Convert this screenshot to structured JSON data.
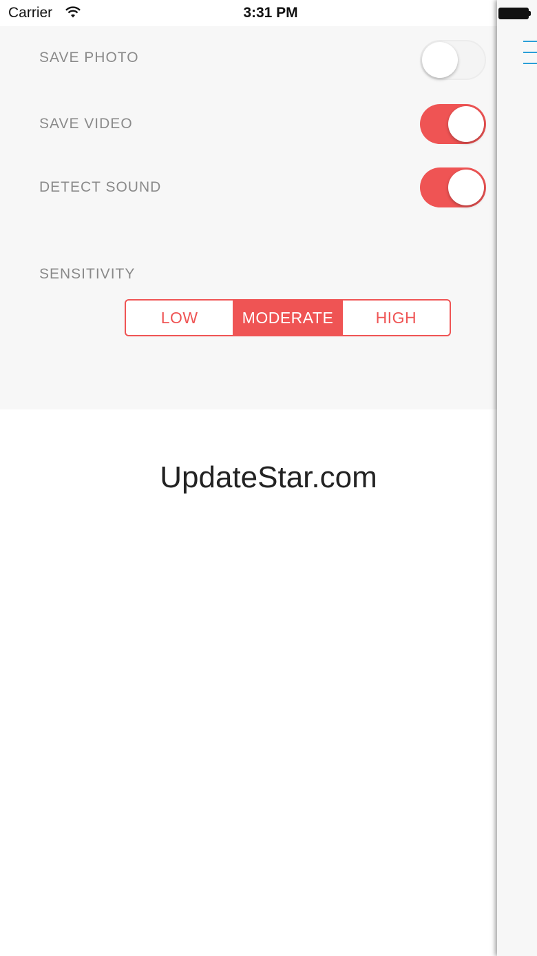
{
  "status_bar": {
    "carrier": "Carrier",
    "time": "3:31 PM",
    "wifi_icon": "wifi-icon",
    "battery_icon": "battery-icon"
  },
  "settings": {
    "save_photo": {
      "label": "SAVE PHOTO",
      "enabled": false
    },
    "save_video": {
      "label": "SAVE VIDEO",
      "enabled": true
    },
    "detect_sound": {
      "label": "DETECT SOUND",
      "enabled": true
    },
    "sensitivity": {
      "label": "SENSITIVITY",
      "options": [
        "LOW",
        "MODERATE",
        "HIGH"
      ],
      "selected": "MODERATE"
    }
  },
  "watermark": "UpdateStar.com",
  "drawer": {
    "menu_icon": "hamburger-menu-icon"
  },
  "colors": {
    "accent": "#ef5454",
    "label": "#8a8a8a",
    "panel_bg": "#f7f7f7",
    "menu_icon": "#2a9fd8"
  }
}
